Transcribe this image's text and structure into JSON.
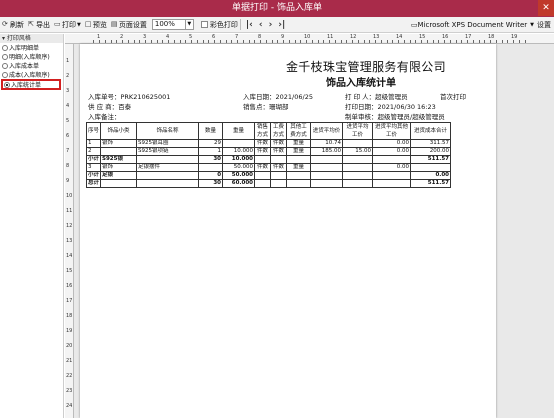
{
  "window": {
    "title": "单据打印 - 饰品入库单",
    "close_label": "✕"
  },
  "toolbar": {
    "refresh": "刷新",
    "export": "导出",
    "print": "打印",
    "preview": "预览",
    "page_setup": "页面设置",
    "zoom": "100%",
    "color_print": "彩色打印",
    "printer": "Microsoft XPS Document Writer",
    "settings": "设置"
  },
  "sidebar": {
    "header": "打印风格",
    "options": [
      {
        "label": "入库明细单"
      },
      {
        "label": "明细(入库顺序)"
      },
      {
        "label": "入库成本单"
      },
      {
        "label": "成本(入库顺序)"
      },
      {
        "label": "入库统计单"
      }
    ],
    "selected_index": 4
  },
  "ruler": {
    "marks": [
      "1",
      "2",
      "3",
      "4",
      "5",
      "6",
      "7",
      "8",
      "9",
      "10",
      "11",
      "12",
      "13",
      "14",
      "15",
      "16",
      "17",
      "18",
      "19"
    ]
  },
  "vruler": {
    "marks": [
      "1",
      "2",
      "3",
      "4",
      "5",
      "6",
      "7",
      "8",
      "9",
      "10",
      "11",
      "12",
      "13",
      "14",
      "15",
      "16",
      "17",
      "18",
      "19",
      "20",
      "21",
      "22",
      "23",
      "24"
    ]
  },
  "document": {
    "company": "金千枝珠宝管理服务有限公司",
    "title": "饰品入库统计单",
    "order_no_label": "入库单号：",
    "order_no": "PRK210625001",
    "date_label": "入库日期：",
    "date": "2021/06/25",
    "printer_label": "打 印 人：",
    "printer": "超级管理员",
    "first_print": "首次打印",
    "supplier_label": "供 应 商：",
    "supplier": "百泰",
    "sales_label": "销售点：",
    "sales": "珊瑚部",
    "print_date_label": "打印日期：",
    "print_date": "2021/06/30 16:23",
    "remark_label": "入库备注：",
    "reviewer_label": "制单审核：",
    "reviewer": "超级管理员/超级管理员"
  },
  "table": {
    "headers": [
      "序号",
      "饰品小类",
      "饰品名称",
      "数量",
      "重量",
      "销售方式",
      "工费方式",
      "其他工费方式",
      "进货平均价",
      "进货平均工价",
      "进货平均其他工价",
      "进货成本合计"
    ],
    "rows": [
      {
        "type": "item",
        "cells": [
          "1",
          "银饰",
          "S925银耳圈",
          "29",
          "",
          "件数",
          "件数",
          "重量",
          "10.74",
          "",
          "0.00",
          "311.57"
        ]
      },
      {
        "type": "item",
        "cells": [
          "2",
          "",
          "S925银项链",
          "1",
          "10.000",
          "件数",
          "件数",
          "重量",
          "185.00",
          "15.00",
          "0.00",
          "200.00"
        ]
      },
      {
        "type": "sub",
        "cells": [
          "小计",
          "S925银",
          "",
          "30",
          "10.000",
          "",
          "",
          "",
          "",
          "",
          "",
          "511.57"
        ]
      },
      {
        "type": "item",
        "cells": [
          "3",
          "银饰",
          "足银摆件",
          "",
          "50.000",
          "件数",
          "件数",
          "重量",
          "",
          "",
          "0.00",
          ""
        ]
      },
      {
        "type": "sub",
        "cells": [
          "小计",
          "足银",
          "",
          "0",
          "50.000",
          "",
          "",
          "",
          "",
          "",
          "",
          "0.00"
        ]
      },
      {
        "type": "total",
        "cells": [
          "总计",
          "",
          "",
          "30",
          "60.000",
          "",
          "",
          "",
          "",
          "",
          "",
          "511.57"
        ]
      }
    ]
  }
}
